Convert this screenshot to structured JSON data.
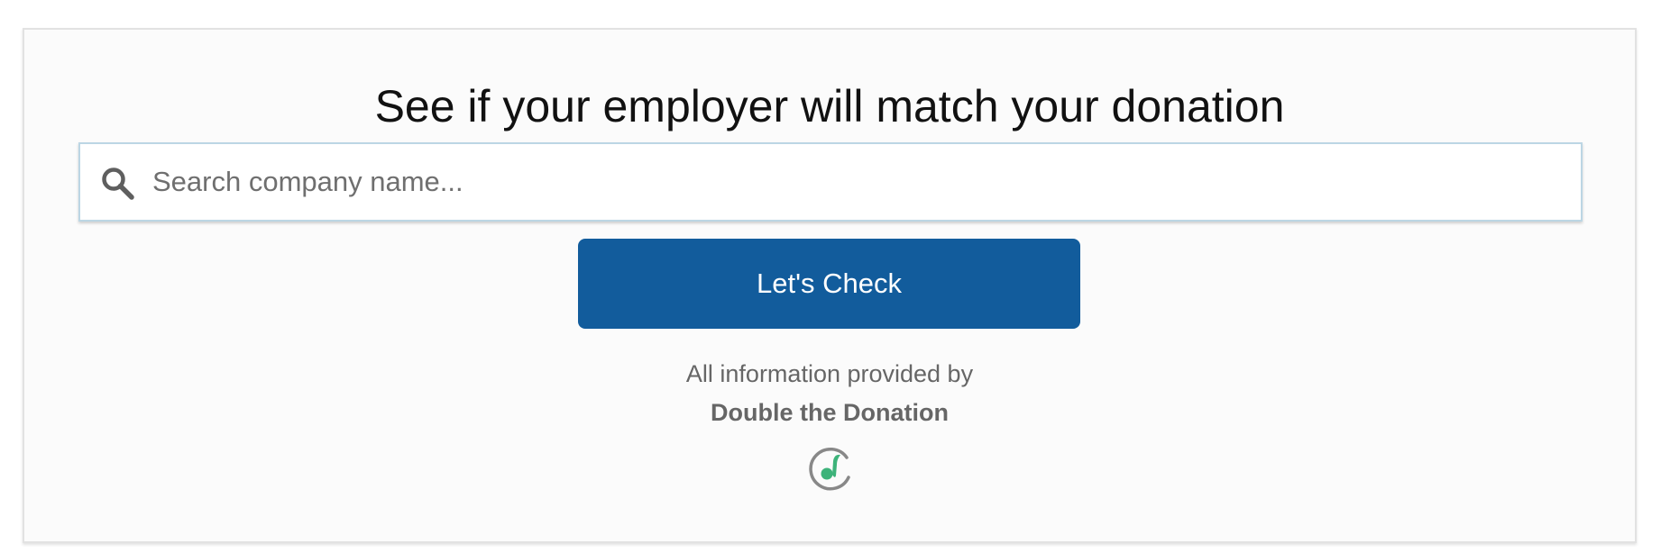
{
  "heading": "See if your employer will match your donation",
  "search": {
    "placeholder": "Search company name...",
    "value": "",
    "icon": "search-icon"
  },
  "button": {
    "label": "Let's Check",
    "color": "#125c9c"
  },
  "attribution": {
    "prefix": "All information provided by",
    "brand": "Double the Donation",
    "logo_icon": "double-the-donation-logo-icon",
    "logo_colors": {
      "ring": "#888888",
      "leaf": "#3db37a"
    }
  }
}
